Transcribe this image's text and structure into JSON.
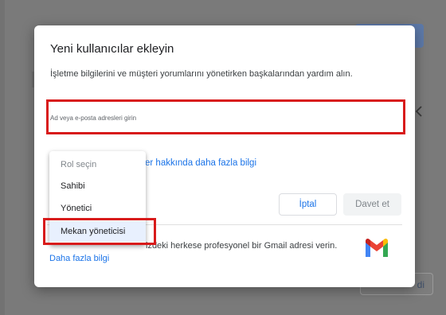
{
  "dialog": {
    "title": "Yeni kullanıcılar ekleyin",
    "subtitle": "İşletme bilgilerini ve müşteri yorumlarını yönetirken başkalarından yardım alın.",
    "input_placeholder": "Ad veya e-posta adresleri girin",
    "learn_more_roles": "er hakkında daha fazla bilgi",
    "cancel_label": "İptal",
    "invite_label": "Davet et",
    "footer_text": "izdeki herkese profesyonel bir Gmail adresi verin.",
    "footer_link": "Daha fazla bilgi"
  },
  "role_menu": {
    "placeholder": "Rol seçin",
    "options": [
      "Sahibi",
      "Yönetici",
      "Mekan yöneticisi"
    ],
    "selected": "Mekan yöneticisi"
  },
  "background": {
    "bottom_button_fragment": "di"
  },
  "colors": {
    "accent_blue": "#1a73e8",
    "highlight_red": "#d81b1b",
    "selected_bg": "#e8f0fe"
  },
  "icons": [
    "gmail-logo-icon",
    "chevron-icon"
  ]
}
